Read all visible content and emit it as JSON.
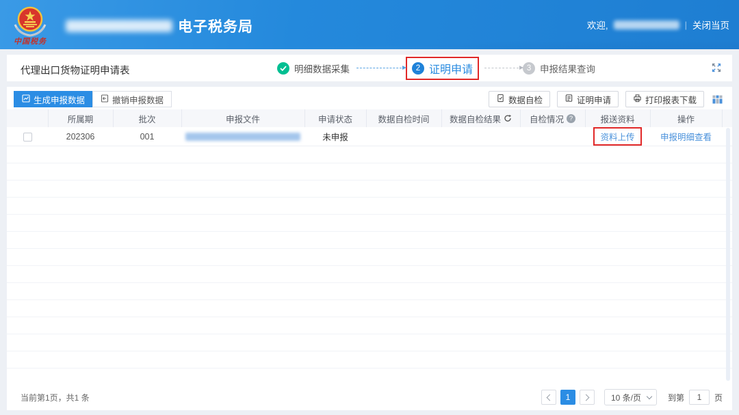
{
  "header": {
    "app_title": "电子税务局",
    "welcome_label": "欢迎,",
    "divider": "|",
    "close_label": "关闭当页",
    "logo_text": "中国税务",
    "org_name_blurred": true,
    "user_name_blurred": true
  },
  "page": {
    "title": "代理出口货物证明申请表"
  },
  "steps": {
    "step1": {
      "label": "明细数据采集",
      "status": "done"
    },
    "step2": {
      "number": "2",
      "label": "证明申请",
      "status": "active",
      "highlighted_red_box": true
    },
    "step3": {
      "number": "3",
      "label": "申报结果查询",
      "status": "pending"
    }
  },
  "tabs": {
    "generate": "生成申报数据",
    "revoke": "撤销申报数据"
  },
  "toolbar": {
    "self_check": "数据自检",
    "cert_apply": "证明申请",
    "print_download": "打印报表下载"
  },
  "table": {
    "headers": [
      "所属期",
      "批次",
      "申报文件",
      "申请状态",
      "数据自检时间",
      "数据自检结果",
      "自检情况",
      "报送资料",
      "操作"
    ],
    "row": {
      "period": "202306",
      "batch": "001",
      "file_blurred": true,
      "status": "未申报",
      "self_check_time": "",
      "self_check_result": "",
      "self_check_info": "",
      "upload": "资料上传",
      "upload_highlighted_red_box": true,
      "detail": "申报明细查看"
    }
  },
  "pagination": {
    "summary": "当前第1页，共1 条",
    "current_page": "1",
    "page_size": "10 条/页",
    "goto_prefix": "到第",
    "goto_value": "1",
    "goto_suffix": "页"
  },
  "icons": [
    "tax-emblem-logo",
    "fullscreen-icon",
    "chart-doc-icon",
    "revoke-doc-icon",
    "doc-check-icon",
    "doc-lines-icon",
    "printer-icon",
    "columns-grid-icon",
    "refresh-icon",
    "help-icon",
    "check-icon",
    "chevron-left-icon",
    "chevron-right-icon",
    "chevron-down-icon"
  ],
  "colors": {
    "accent_blue": "#2b8de4",
    "link_blue": "#4a91db",
    "step_done_green": "#00bf92",
    "annotation_red": "#e12727",
    "header_blue_top": "#3a9ae6",
    "header_blue_bottom": "#1e7ed2",
    "page_bg": "#edf0f5",
    "table_header_bg": "#f6f7fa"
  }
}
